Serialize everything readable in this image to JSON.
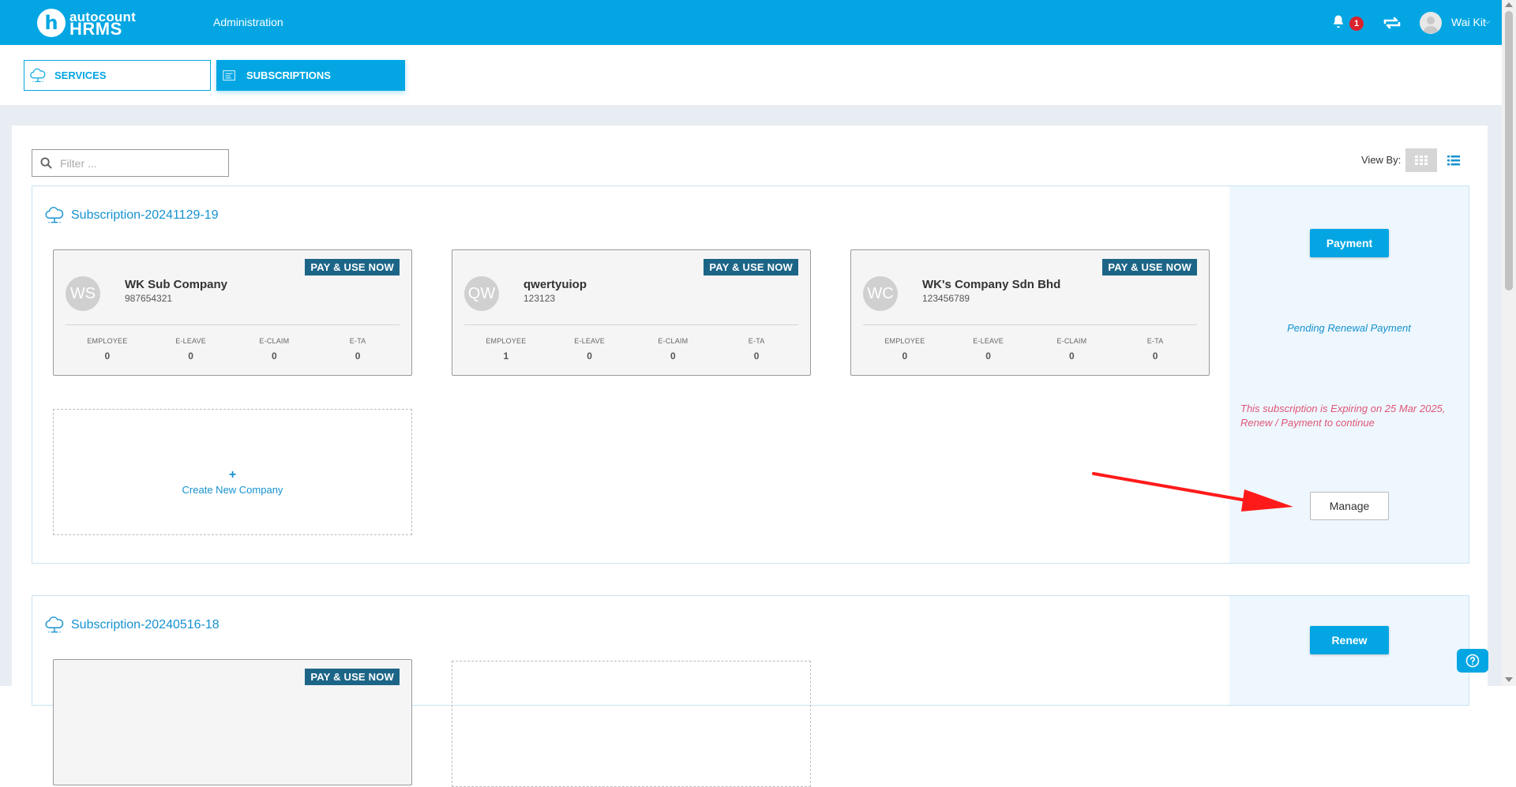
{
  "header": {
    "logo_small": "autocount",
    "logo_big": "HRMS",
    "logo_letter": "h",
    "nav_admin": "Administration",
    "notification_count": "1",
    "user_name": "Wai Kit"
  },
  "tabs": {
    "services": "SERVICES",
    "subscriptions": "SUBSCRIPTIONS",
    "active": "subscriptions"
  },
  "toolbar": {
    "filter_placeholder": "Filter ...",
    "view_by_label": "View By:"
  },
  "subscriptions": [
    {
      "title": "Subscription-20241129-19",
      "action_button": "Payment",
      "status": "Pending Renewal Payment",
      "warning": "This subscription is Expiring on 25 Mar 2025, Renew / Payment to continue",
      "manage_button": "Manage",
      "create_plus": "+",
      "create_label": "Create New Company",
      "companies": [
        {
          "initials": "WS",
          "name": "WK Sub Company",
          "code": "987654321",
          "badge": "PAY & USE NOW",
          "stats": [
            {
              "label": "EMPLOYEE",
              "value": "0"
            },
            {
              "label": "E-LEAVE",
              "value": "0"
            },
            {
              "label": "E-CLAIM",
              "value": "0"
            },
            {
              "label": "E-TA",
              "value": "0"
            }
          ]
        },
        {
          "initials": "QW",
          "name": "qwertyuiop",
          "code": "123123",
          "badge": "PAY & USE NOW",
          "stats": [
            {
              "label": "EMPLOYEE",
              "value": "1"
            },
            {
              "label": "E-LEAVE",
              "value": "0"
            },
            {
              "label": "E-CLAIM",
              "value": "0"
            },
            {
              "label": "E-TA",
              "value": "0"
            }
          ]
        },
        {
          "initials": "WC",
          "name": "WK's Company Sdn Bhd",
          "code": "123456789",
          "badge": "PAY & USE NOW",
          "stats": [
            {
              "label": "EMPLOYEE",
              "value": "0"
            },
            {
              "label": "E-LEAVE",
              "value": "0"
            },
            {
              "label": "E-CLAIM",
              "value": "0"
            },
            {
              "label": "E-TA",
              "value": "0"
            }
          ]
        }
      ]
    },
    {
      "title": "Subscription-20240516-18",
      "action_button": "Renew",
      "companies": [
        {
          "badge": "PAY & USE NOW"
        }
      ]
    }
  ],
  "colors": {
    "brand": "#03a6e3",
    "badge_dark": "#1c6587",
    "warning": "#e05577",
    "notification": "#d9232d",
    "annotation_arrow": "#ff1a1a"
  }
}
